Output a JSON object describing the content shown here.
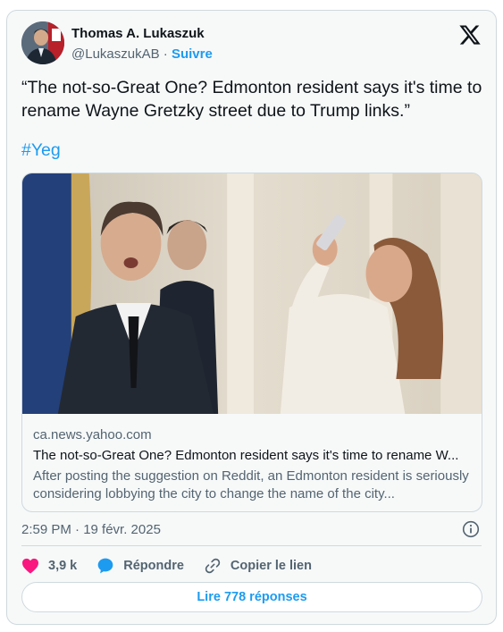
{
  "author": {
    "name": "Thomas A. Lukaszuk",
    "handle": "@LukaszukAB",
    "separator": "·",
    "follow_label": "Suivre"
  },
  "icons": {
    "brand": "x-logo-icon",
    "info": "info-icon",
    "like": "heart-icon",
    "reply": "speech-bubble-icon",
    "copy": "link-icon"
  },
  "tweet": {
    "text": "“The not-so-Great One? Edmonton resident says it's time to rename Wayne Gretzky street due to Trump links.”",
    "hashtag": "#Yeg"
  },
  "link_card": {
    "domain": "ca.news.yahoo.com",
    "title": "The not-so-Great One? Edmonton resident says it's time to rename W...",
    "description": "After posting the suggestion on Reddit, an Edmonton resident is seriously considering lobbying the city to change the name of the city..."
  },
  "meta": {
    "timestamp": "2:59 PM · 19 févr. 2025"
  },
  "actions": {
    "likes": "3,9 k",
    "reply_label": "Répondre",
    "copy_label": "Copier le lien"
  },
  "read_replies_label": "Lire 778 réponses",
  "colors": {
    "accent": "#1d9bf0",
    "like": "#f91880",
    "text": "#0f1419",
    "muted": "#536471",
    "border": "#cfd9de"
  }
}
